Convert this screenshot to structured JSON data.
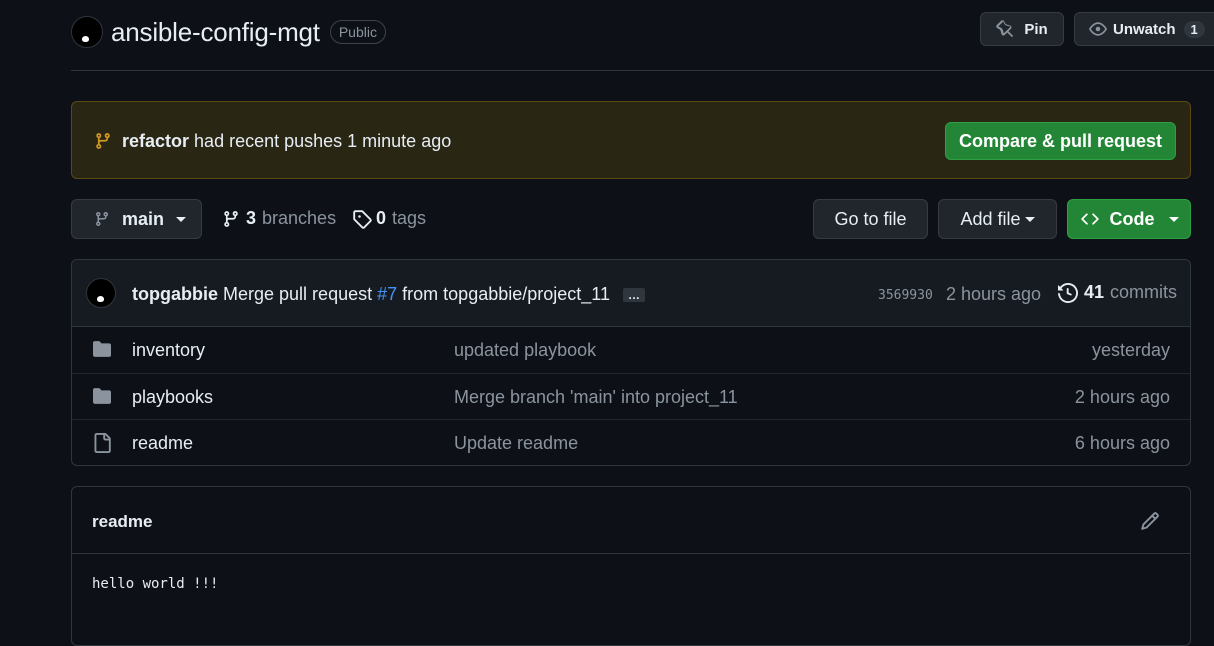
{
  "header": {
    "repo_name": "ansible-config-mgt",
    "visibility": "Public",
    "pin_label": "Pin",
    "unwatch_label": "Unwatch",
    "watch_count": "1"
  },
  "banner": {
    "branch": "refactor",
    "text": "had recent pushes 1 minute ago",
    "compare_label": "Compare & pull request"
  },
  "toolbar": {
    "branch": "main",
    "branches_count": "3",
    "branches_label": "branches",
    "tags_count": "0",
    "tags_label": "tags",
    "goto_label": "Go to file",
    "addfile_label": "Add file",
    "code_label": "Code"
  },
  "latest_commit": {
    "author": "topgabbie",
    "msg_pre": "Merge pull request",
    "pr_link": "#7",
    "msg_post": "from topgabbie/project_11",
    "ellipsis": "…",
    "sha": "3569930",
    "time": "2 hours ago",
    "commit_count": "41",
    "commits_label": "commits"
  },
  "files": [
    {
      "name": "inventory",
      "type": "folder",
      "message": "updated playbook",
      "time": "yesterday"
    },
    {
      "name": "playbooks",
      "type": "folder",
      "message": "Merge branch 'main' into project_11",
      "time": "2 hours ago"
    },
    {
      "name": "readme",
      "type": "file",
      "message": "Update readme",
      "time": "6 hours ago"
    }
  ],
  "readme": {
    "title": "readme",
    "body": "hello world !!!"
  },
  "colors": {
    "background": "#0d1117",
    "primary_button": "#238636",
    "link": "#4493f8",
    "banner_bg": "#2a2614",
    "banner_icon": "#d29922"
  }
}
